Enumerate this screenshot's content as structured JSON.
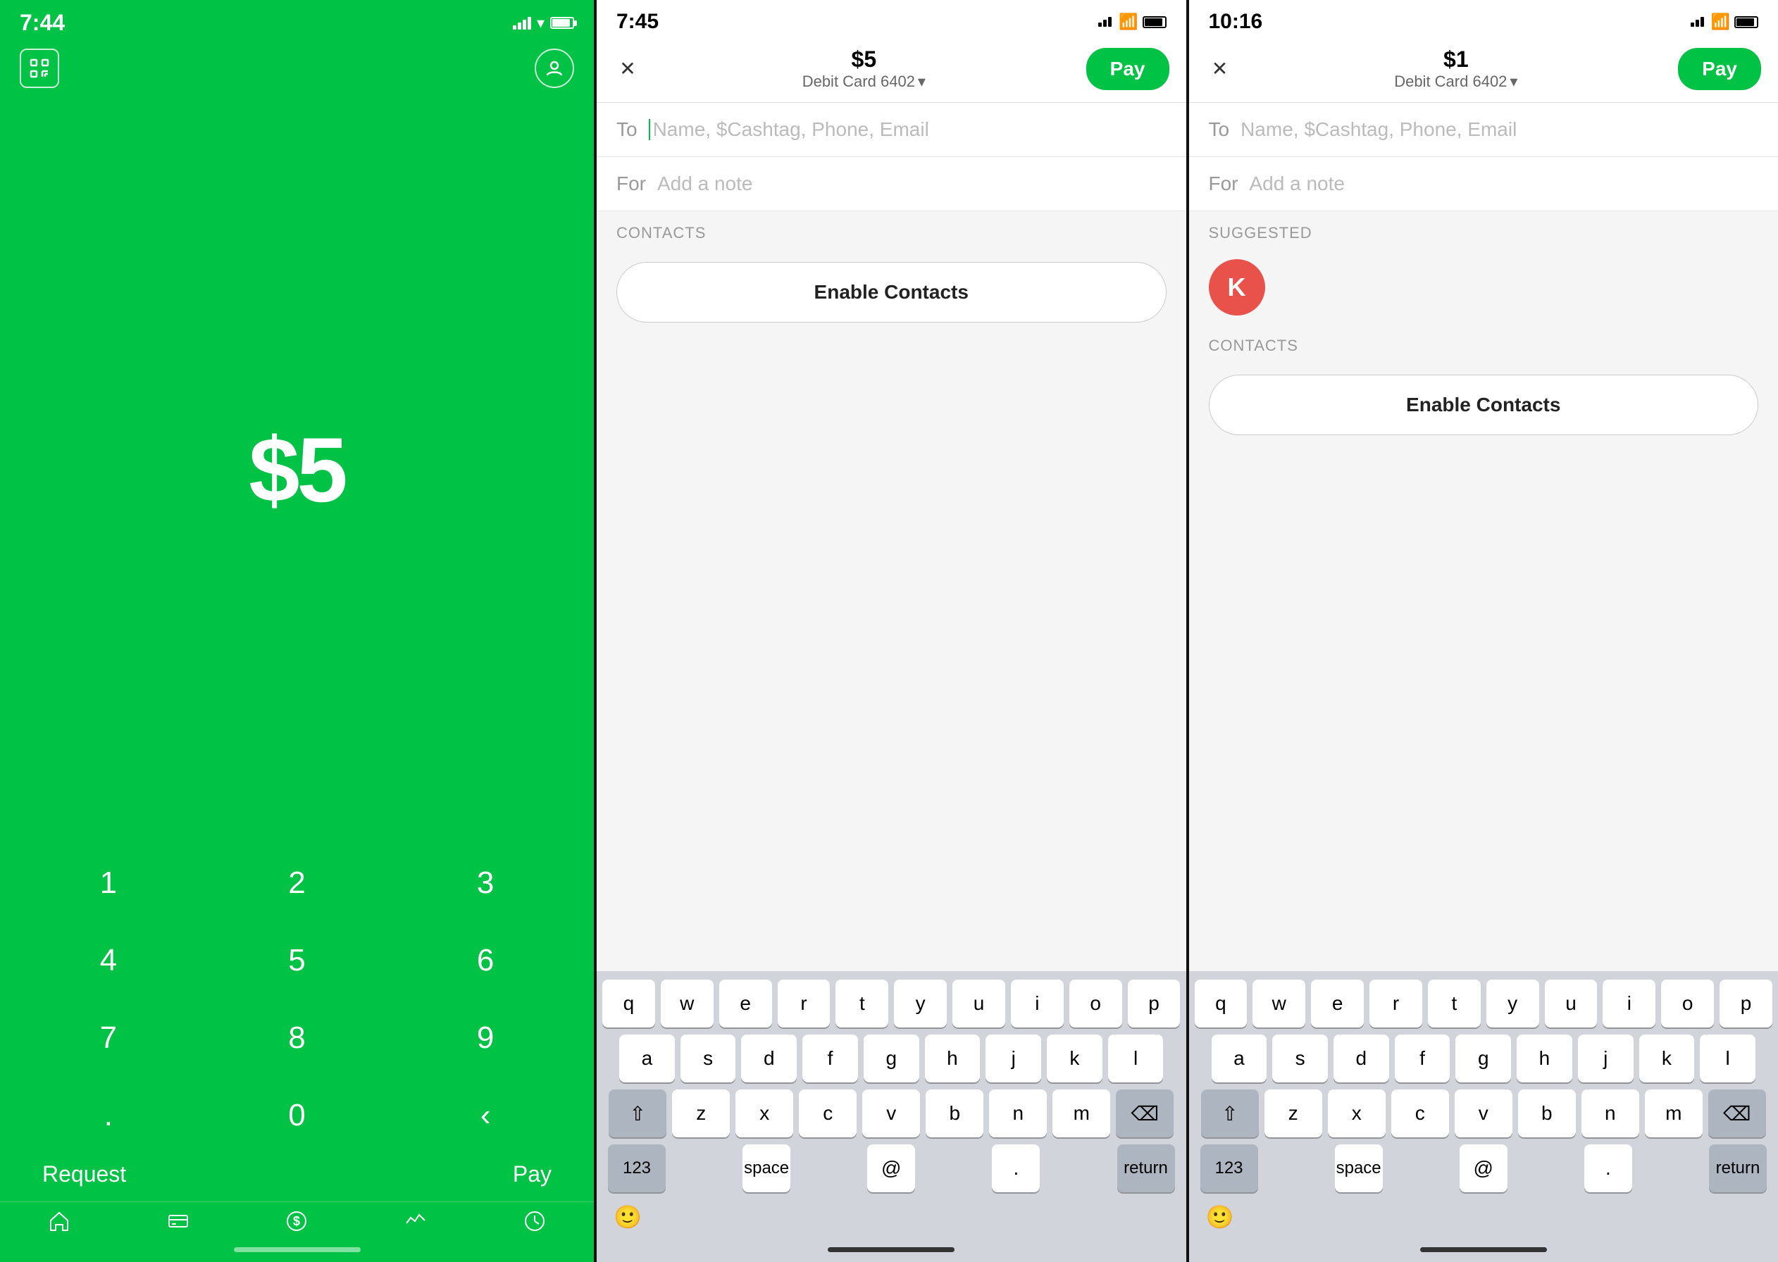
{
  "screen1": {
    "status_bar": {
      "time": "7:44",
      "battery_level": 90
    },
    "amount": "$5",
    "numpad": {
      "keys": [
        "1",
        "2",
        "3",
        "4",
        "5",
        "6",
        "7",
        "8",
        "9",
        ".",
        "0",
        "⌫"
      ]
    },
    "actions": {
      "request": "Request",
      "pay": "Pay"
    },
    "nav_icons": [
      "home",
      "card",
      "dollar",
      "activity",
      "clock"
    ]
  },
  "screen2": {
    "status_bar": {
      "time": "7:45"
    },
    "header": {
      "close_label": "✕",
      "amount": "$5",
      "card": "Debit Card 6402",
      "pay_label": "Pay"
    },
    "to_label": "To",
    "to_placeholder": "Name, $Cashtag, Phone, Email",
    "for_label": "For",
    "for_placeholder": "Add a note",
    "contacts_section": "CONTACTS",
    "enable_contacts_label": "Enable Contacts",
    "keyboard": {
      "rows": [
        [
          "q",
          "w",
          "e",
          "r",
          "t",
          "y",
          "u",
          "i",
          "o",
          "p"
        ],
        [
          "a",
          "s",
          "d",
          "f",
          "g",
          "h",
          "j",
          "k",
          "l"
        ],
        [
          "z",
          "x",
          "c",
          "v",
          "b",
          "n",
          "m"
        ]
      ],
      "bottom": {
        "num": "123",
        "space": "space",
        "at": "@",
        "dot": ".",
        "return": "return"
      }
    }
  },
  "screen3": {
    "status_bar": {
      "time": "10:16"
    },
    "header": {
      "close_label": "✕",
      "amount": "$1",
      "card": "Debit Card 6402",
      "pay_label": "Pay"
    },
    "to_label": "To",
    "to_placeholder": "Name, $Cashtag, Phone, Email",
    "for_label": "For",
    "for_placeholder": "Add a note",
    "suggested_section": "SUGGESTED",
    "suggested_avatar_letter": "K",
    "contacts_section": "CONTACTS",
    "enable_contacts_label": "Enable Contacts",
    "keyboard": {
      "rows": [
        [
          "q",
          "w",
          "e",
          "r",
          "t",
          "y",
          "u",
          "i",
          "o",
          "p"
        ],
        [
          "a",
          "s",
          "d",
          "f",
          "g",
          "h",
          "j",
          "k",
          "l"
        ],
        [
          "z",
          "x",
          "c",
          "v",
          "b",
          "n",
          "m"
        ]
      ],
      "bottom": {
        "num": "123",
        "space": "space",
        "at": "@",
        "dot": ".",
        "return": "return"
      }
    }
  },
  "colors": {
    "green": "#00C244",
    "red": "#e8524a",
    "dark": "#111111",
    "light_bg": "#f5f5f5",
    "white": "#ffffff"
  }
}
